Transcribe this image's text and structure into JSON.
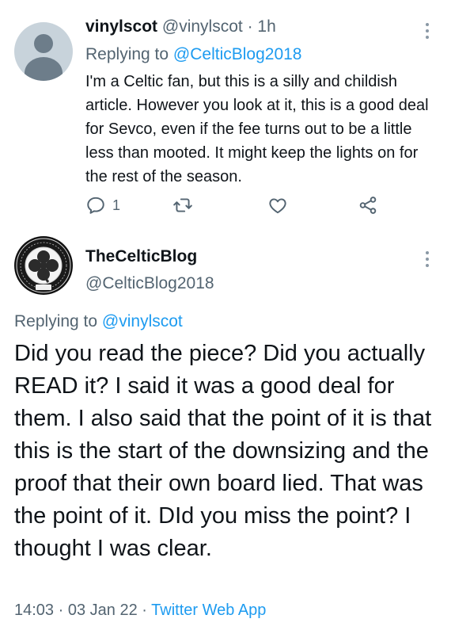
{
  "reply_tweet": {
    "author_name": "vinylscot",
    "author_handle": "@vinylscot",
    "separator": "·",
    "time": "1h",
    "replying_prefix": "Replying to",
    "replying_to": "@CelticBlog2018",
    "text": "I'm a Celtic fan, but this is a silly and childish article. However you look at it, this is a good deal for Sevco, even if the fee turns out to be a little less than mooted. It might keep the lights on for the rest of the season.",
    "reply_count": "1",
    "icons": [
      "reply-icon",
      "retweet-icon",
      "like-icon",
      "share-icon"
    ]
  },
  "main_tweet": {
    "author_name": "TheCelticBlog",
    "author_handle": "@CelticBlog2018",
    "replying_prefix": "Replying to",
    "replying_to": "@vinylscot",
    "text": "Did you read the piece? Did you actually READ it? I said it was a good deal for them. I also said that the point of it is that this is the start of the downsizing and the proof that their own board lied. That was the point of it. DId you miss the point? I thought I was clear.",
    "time": "14:03",
    "date": "03 Jan 22",
    "separator": "·",
    "source": "Twitter Web App"
  },
  "colors": {
    "text": "#0f1419",
    "secondary": "#536471",
    "link": "#1d9bf0",
    "crest_green": "#2f6a3a"
  }
}
